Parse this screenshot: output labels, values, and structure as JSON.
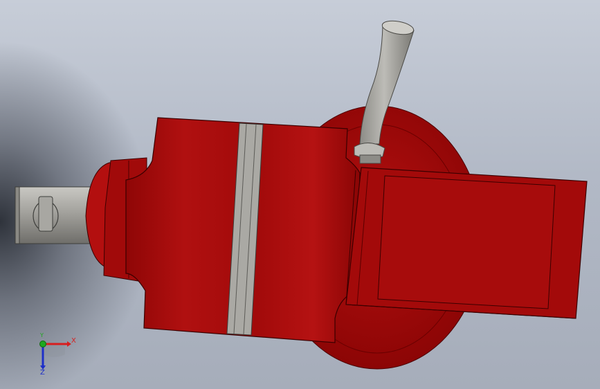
{
  "viewport": {
    "colors": {
      "body_red": "#a30a0a",
      "body_red_dark": "#6e0000",
      "steel": "#a9a8a3",
      "background": "#b8bfcb"
    }
  },
  "triad": {
    "x_label": "X",
    "y_label": "Y",
    "z_label": "Z",
    "x_color": "#d81e1e",
    "y_color": "#1fa81f",
    "z_color": "#1e2fc8"
  }
}
